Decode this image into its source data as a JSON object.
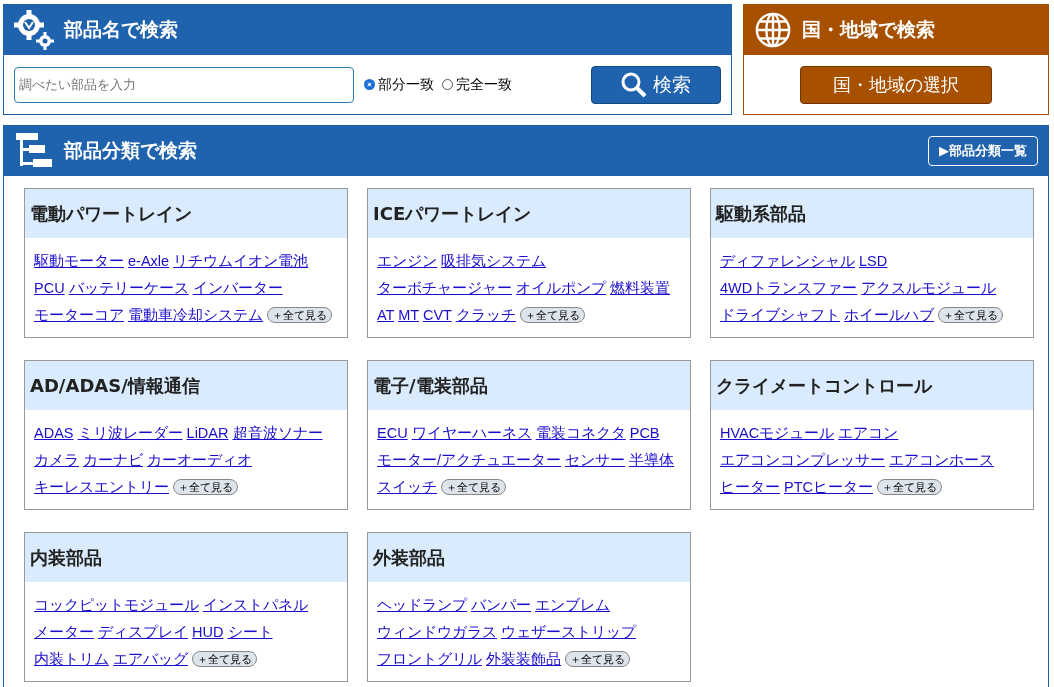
{
  "name_search": {
    "title": "部品名で検索",
    "placeholder": "調べたい部品を入力",
    "match_options": [
      {
        "label": "部分一致",
        "selected": true
      },
      {
        "label": "完全一致",
        "selected": false
      }
    ],
    "button": "検索"
  },
  "region_search": {
    "title": "国・地域で検索",
    "button": "国・地域の選択"
  },
  "category_search": {
    "title": "部品分類で検索",
    "list_button": "▶部品分類一覧",
    "categories": [
      {
        "title": "電動パワートレイン",
        "links": [
          "駆動モーター",
          "e-Axle",
          "リチウムイオン電池",
          "PCU",
          "バッテリーケース",
          "インバーター",
          "モーターコア",
          "電動車冷却システム"
        ],
        "more": "＋全て見る"
      },
      {
        "title": "ICEパワートレイン",
        "links": [
          "エンジン",
          "吸排気システム",
          "ターボチャージャー",
          "オイルポンプ",
          "燃料装置",
          "AT",
          "MT",
          "CVT",
          "クラッチ"
        ],
        "more": "＋全て見る"
      },
      {
        "title": "駆動系部品",
        "links": [
          "ディファレンシャル",
          "LSD",
          "4WDトランスファー",
          "アクスルモジュール",
          "ドライブシャフト",
          "ホイールハブ"
        ],
        "more": "＋全て見る"
      },
      {
        "title": "AD/ADAS/情報通信",
        "links": [
          "ADAS",
          "ミリ波レーダー",
          "LiDAR",
          "超音波ソナー",
          "カメラ",
          "カーナビ",
          "カーオーディオ",
          "キーレスエントリー"
        ],
        "more": "＋全て見る"
      },
      {
        "title": "電子/電装部品",
        "links": [
          "ECU",
          "ワイヤーハーネス",
          "電装コネクタ",
          "PCB",
          "モーター/アクチュエーター",
          "センサー",
          "半導体",
          "スイッチ"
        ],
        "more": "＋全て見る"
      },
      {
        "title": "クライメートコントロール",
        "links": [
          "HVACモジュール",
          "エアコン",
          "エアコンコンプレッサー",
          "エアコンホース",
          "ヒーター",
          "PTCヒーター"
        ],
        "more": "＋全て見る"
      },
      {
        "title": "内装部品",
        "links": [
          "コックピットモジュール",
          "インストパネル",
          "メーター",
          "ディスプレイ",
          "HUD",
          "シート",
          "内装トリム",
          "エアバッグ"
        ],
        "more": "＋全て見る"
      },
      {
        "title": "外装部品",
        "links": [
          "ヘッドランプ",
          "バンパー",
          "エンブレム",
          "ウィンドウガラス",
          "ウェザーストリップ",
          "フロントグリル",
          "外装装飾品"
        ],
        "more": "＋全て見る"
      }
    ]
  }
}
